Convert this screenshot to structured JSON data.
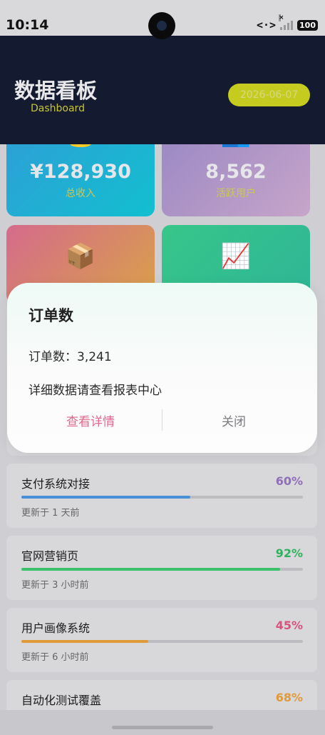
{
  "status_bar": {
    "time": "10:14",
    "network_label": "<·>",
    "battery": "100"
  },
  "header": {
    "title": "数据看板",
    "subtitle": "Dashboard",
    "date": "2026-06-07"
  },
  "stats": [
    {
      "icon": "💰",
      "value": "¥128,930",
      "label": "总收入"
    },
    {
      "icon": "👥",
      "value": "8,562",
      "label": "活跃用户"
    },
    {
      "icon": "📦",
      "value": "",
      "label": ""
    },
    {
      "icon": "📈",
      "value": "",
      "label": ""
    }
  ],
  "dialog": {
    "title": "订单数",
    "line1": "订单数：3,241",
    "line2": "详细数据请查看报表中心",
    "primary_label": "查看详情",
    "close_label": "关闭"
  },
  "projects": [
    {
      "name": "支付系统对接",
      "percent_label": "60%",
      "progress": 0.6,
      "color": "#4a90d9",
      "pct_color": "#8e6fb8",
      "updated": "更新于 1 天前"
    },
    {
      "name": "官网营销页",
      "percent_label": "92%",
      "progress": 0.92,
      "color": "#3cc06a",
      "pct_color": "#2fb15e",
      "updated": "更新于 3 小时前"
    },
    {
      "name": "用户画像系统",
      "percent_label": "45%",
      "progress": 0.45,
      "color": "#e09a3a",
      "pct_color": "#d9527e",
      "updated": "更新于 6 小时前"
    },
    {
      "name": "自动化测试覆盖",
      "percent_label": "68%",
      "progress": 0.68,
      "color": "#e09a3a",
      "pct_color": "#e09a3a",
      "updated": ""
    }
  ]
}
